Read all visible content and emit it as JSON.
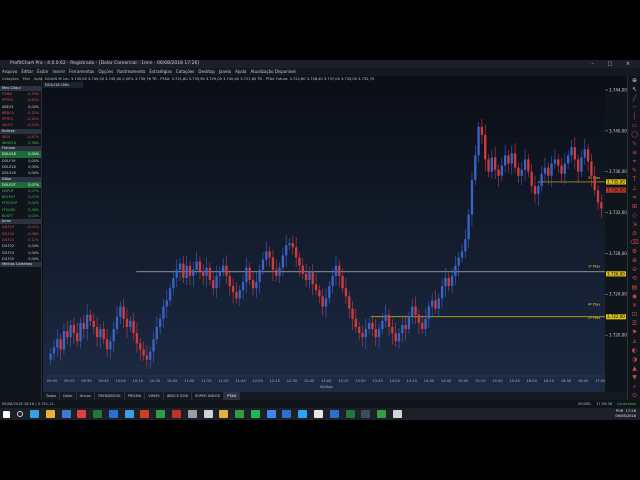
{
  "window": {
    "title": "ProfitChart Pro - 4.0.0.62 - Registrado - [Dolar Comercial - 1min - 06/08/2018 17:26]",
    "controls": [
      "–",
      "□",
      "×"
    ]
  },
  "menu": [
    "Arquivo",
    "Editar",
    "Exibir",
    "Inserir",
    "Ferramentas",
    "Opções",
    "Rastreamento",
    "Estratégias",
    "Cotações",
    "Desktop",
    "Janela",
    "Ajuda",
    "Atualização Disponível"
  ],
  "sidebar": {
    "tabs": [
      "Cotações",
      "Mini",
      "Ações"
    ],
    "sections": [
      {
        "title": "Mini Cliqui",
        "rows": [
          {
            "sym": "ITUB4",
            "chg": "-0,75%",
            "cls": "neg"
          },
          {
            "sym": "PETR4",
            "chg": "-0,62%",
            "cls": "neg"
          },
          {
            "sym": "ABEV3",
            "chg": "0,00%",
            "cls": "neu"
          },
          {
            "sym": "BBDC4",
            "chg": "-0,32%",
            "cls": "neg"
          },
          {
            "sym": "PETR3",
            "chg": "-0,41%",
            "cls": "neg"
          },
          {
            "sym": "VALE3",
            "chg": "-0,22%",
            "cls": "neg"
          }
        ]
      },
      {
        "title": "Índices",
        "rows": [
          {
            "sym": "IBOV",
            "chg": "-0,47%",
            "cls": "neg"
          },
          {
            "sym": "WINQ18",
            "chg": "0,36%",
            "cls": "pos"
          }
        ]
      },
      {
        "title": "Futuros",
        "rows": [
          {
            "sym": "DOLU18",
            "chg": "0,00%",
            "cls": "neu",
            "hl": true
          },
          {
            "sym": "DOLF19",
            "chg": "0,00%",
            "cls": "neu"
          },
          {
            "sym": "DOLZ18",
            "chg": "0,00%",
            "cls": "neu"
          },
          {
            "sym": "DOLX18",
            "chg": "0,00%",
            "cls": "neu"
          }
        ]
      },
      {
        "title": "Dólar",
        "rows": [
          {
            "sym": "DOLFUT",
            "chg": "0,07%",
            "cls": "pos",
            "hl": true
          },
          {
            "sym": "DOPUT",
            "chg": "0,07%",
            "cls": "pos"
          },
          {
            "sym": "BRLPUT",
            "chg": "0,07%",
            "cls": "pos"
          },
          {
            "sym": "FFSOZHF",
            "chg": "0,02%",
            "cls": "pos"
          },
          {
            "sym": "FFSUDV",
            "chg": "0,36%",
            "cls": "pos"
          },
          {
            "sym": "BOSFT",
            "chg": "0,03%",
            "cls": "pos"
          }
        ]
      },
      {
        "title": "Juros",
        "rows": [
          {
            "sym": "DI1F19",
            "chg": "-0,01%",
            "cls": "neg"
          },
          {
            "sym": "DI1F20",
            "chg": "-0,08%",
            "cls": "neg"
          },
          {
            "sym": "DI1F21",
            "chg": "-0,12%",
            "cls": "neg"
          },
          {
            "sym": "DI1F22",
            "chg": "0,00%",
            "cls": "neu"
          },
          {
            "sym": "DI1F23",
            "chg": "0,00%",
            "cls": "neu"
          },
          {
            "sym": "DI1F25",
            "chg": "0,00%",
            "cls": "neu"
          }
        ]
      },
      {
        "title": "Minhas Carteiras",
        "rows": []
      }
    ]
  },
  "chart_header": "DOLUS M 1m: 3.745,00 3.745,00 3.745,00 0,00% 3.739,76 TR - PTAX: 3.721,60 3.739,90 3.729,00 3.740,00 3.721,60 TR - PTAX Futuro: 3.722,60 3.738,40 3.737,00 3.733,00 3.732,70",
  "chart_tab": "DOLU18 1Min",
  "chart_data": {
    "type": "candlestick",
    "y_tick_labels": [
      "3.744,00",
      "3.740,00",
      "3.736,00",
      "3.732,00",
      "3.728,00",
      "3.724,00",
      "3.720,00"
    ],
    "ylim": [
      3716.0,
      3744.0
    ],
    "x_tick_labels": [
      "09:00",
      "09:15",
      "09:30",
      "09:45",
      "10:00",
      "10:15",
      "10:30",
      "10:45",
      "11:00",
      "11:15",
      "11:30",
      "11:45",
      "12:00",
      "12:15",
      "12:30",
      "12:45",
      "13:00",
      "13:15",
      "13:30",
      "13:45",
      "14:00",
      "14:15",
      "14:30",
      "14:45",
      "15:00",
      "15:15",
      "15:30",
      "15:45",
      "16:00",
      "16:15",
      "16:30",
      "16:45",
      "17:00"
    ],
    "xlabel": "06/Ago",
    "price_labels": [
      {
        "text": "3.735,00",
        "value": 3735.0,
        "bg": "#d9c21a"
      },
      {
        "text": "3.734,00",
        "value": 3734.2,
        "bg": "#c0392b"
      },
      {
        "text": "3.726,00",
        "value": 3726.0,
        "bg": "#d9c21a"
      },
      {
        "text": "3.722,00",
        "value": 3721.8,
        "bg": "#d9c21a"
      }
    ],
    "horizontal_lines": [
      {
        "value": 3726.2,
        "color": "#d8d8d8",
        "label": "1ª Ptax",
        "start_frac": 0.16
      },
      {
        "value": 3721.8,
        "color": "#d9c21a",
        "label": "2ª Ptax",
        "start_frac": 0.58
      },
      {
        "value": 3735.0,
        "color": "#d9c21a",
        "label": "3ª Ptax",
        "start_frac": 0.88
      }
    ],
    "line_labels": [
      {
        "text": "3ª Ptax",
        "value": 3735.3
      },
      {
        "text": "1ª Ptax",
        "value": 3726.6
      },
      {
        "text": "4ª Ptax",
        "value": 3722.9
      },
      {
        "text": "2ª Ptax",
        "value": 3721.6
      }
    ],
    "closes": [
      3718.2,
      3718.8,
      3719.6,
      3718.6,
      3720.4,
      3719.8,
      3721.0,
      3720.2,
      3719.4,
      3721.2,
      3720.6,
      3722.0,
      3721.4,
      3720.8,
      3719.8,
      3720.6,
      3719.6,
      3718.6,
      3719.4,
      3720.6,
      3721.8,
      3722.8,
      3721.6,
      3720.8,
      3721.4,
      3720.2,
      3719.2,
      3718.6,
      3718.0,
      3717.6,
      3718.4,
      3719.6,
      3720.8,
      3721.6,
      3722.8,
      3723.4,
      3724.6,
      3725.6,
      3726.4,
      3727.0,
      3725.6,
      3726.8,
      3725.8,
      3726.4,
      3727.2,
      3726.2,
      3725.8,
      3726.6,
      3725.4,
      3724.6,
      3725.8,
      3726.2,
      3726.8,
      3725.8,
      3724.8,
      3724.2,
      3723.6,
      3724.4,
      3725.2,
      3726.6,
      3725.4,
      3724.6,
      3725.2,
      3726.4,
      3727.4,
      3728.2,
      3727.6,
      3726.4,
      3725.8,
      3726.6,
      3727.8,
      3728.8,
      3729.0,
      3728.6,
      3727.6,
      3726.8,
      3726.0,
      3725.4,
      3726.2,
      3725.0,
      3724.4,
      3723.8,
      3722.8,
      3723.6,
      3724.8,
      3725.8,
      3726.8,
      3725.8,
      3724.6,
      3723.8,
      3722.6,
      3721.6,
      3720.8,
      3720.2,
      3719.8,
      3720.6,
      3721.2,
      3720.6,
      3719.8,
      3720.6,
      3721.4,
      3722.0,
      3720.8,
      3720.2,
      3719.4,
      3720.2,
      3721.0,
      3720.6,
      3721.8,
      3722.8,
      3722.0,
      3721.2,
      3720.6,
      3721.6,
      3722.8,
      3723.4,
      3722.6,
      3723.6,
      3724.8,
      3725.6,
      3724.8,
      3725.8,
      3726.8,
      3727.6,
      3728.2,
      3729.4,
      3731.8,
      3735.2,
      3737.6,
      3740.4,
      3739.6,
      3737.2,
      3736.0,
      3737.4,
      3736.2,
      3735.6,
      3736.6,
      3737.6,
      3736.8,
      3737.8,
      3736.4,
      3735.6,
      3736.2,
      3737.2,
      3736.0,
      3734.6,
      3733.8,
      3734.6,
      3735.8,
      3736.4,
      3735.6,
      3736.8,
      3737.2,
      3736.6,
      3735.8,
      3736.8,
      3737.6,
      3738.4,
      3737.2,
      3736.0,
      3737.4,
      3738.2,
      3737.0,
      3735.6,
      3734.2,
      3733.0,
      3732.4
    ]
  },
  "bottom_tabs": [
    "Todos",
    "Dolar",
    "Ativos",
    "TRENDBOOK",
    "PRISMA",
    "VWMS",
    "INDICE ROB",
    "SUPER INDICE",
    "PTAX"
  ],
  "bottom_active": "PTAX",
  "status": {
    "left": "06/08/2018 16:18 | 3.741,12",
    "right": [
      "VISIVEL",
      "17:26:38",
      "Conectado"
    ]
  },
  "tray": {
    "lang": "POR",
    "time": "17:26",
    "date": "06/08/2018"
  },
  "colors": {
    "up": "#3a63c9",
    "down": "#d23b3b",
    "grid": "#1a2230"
  }
}
